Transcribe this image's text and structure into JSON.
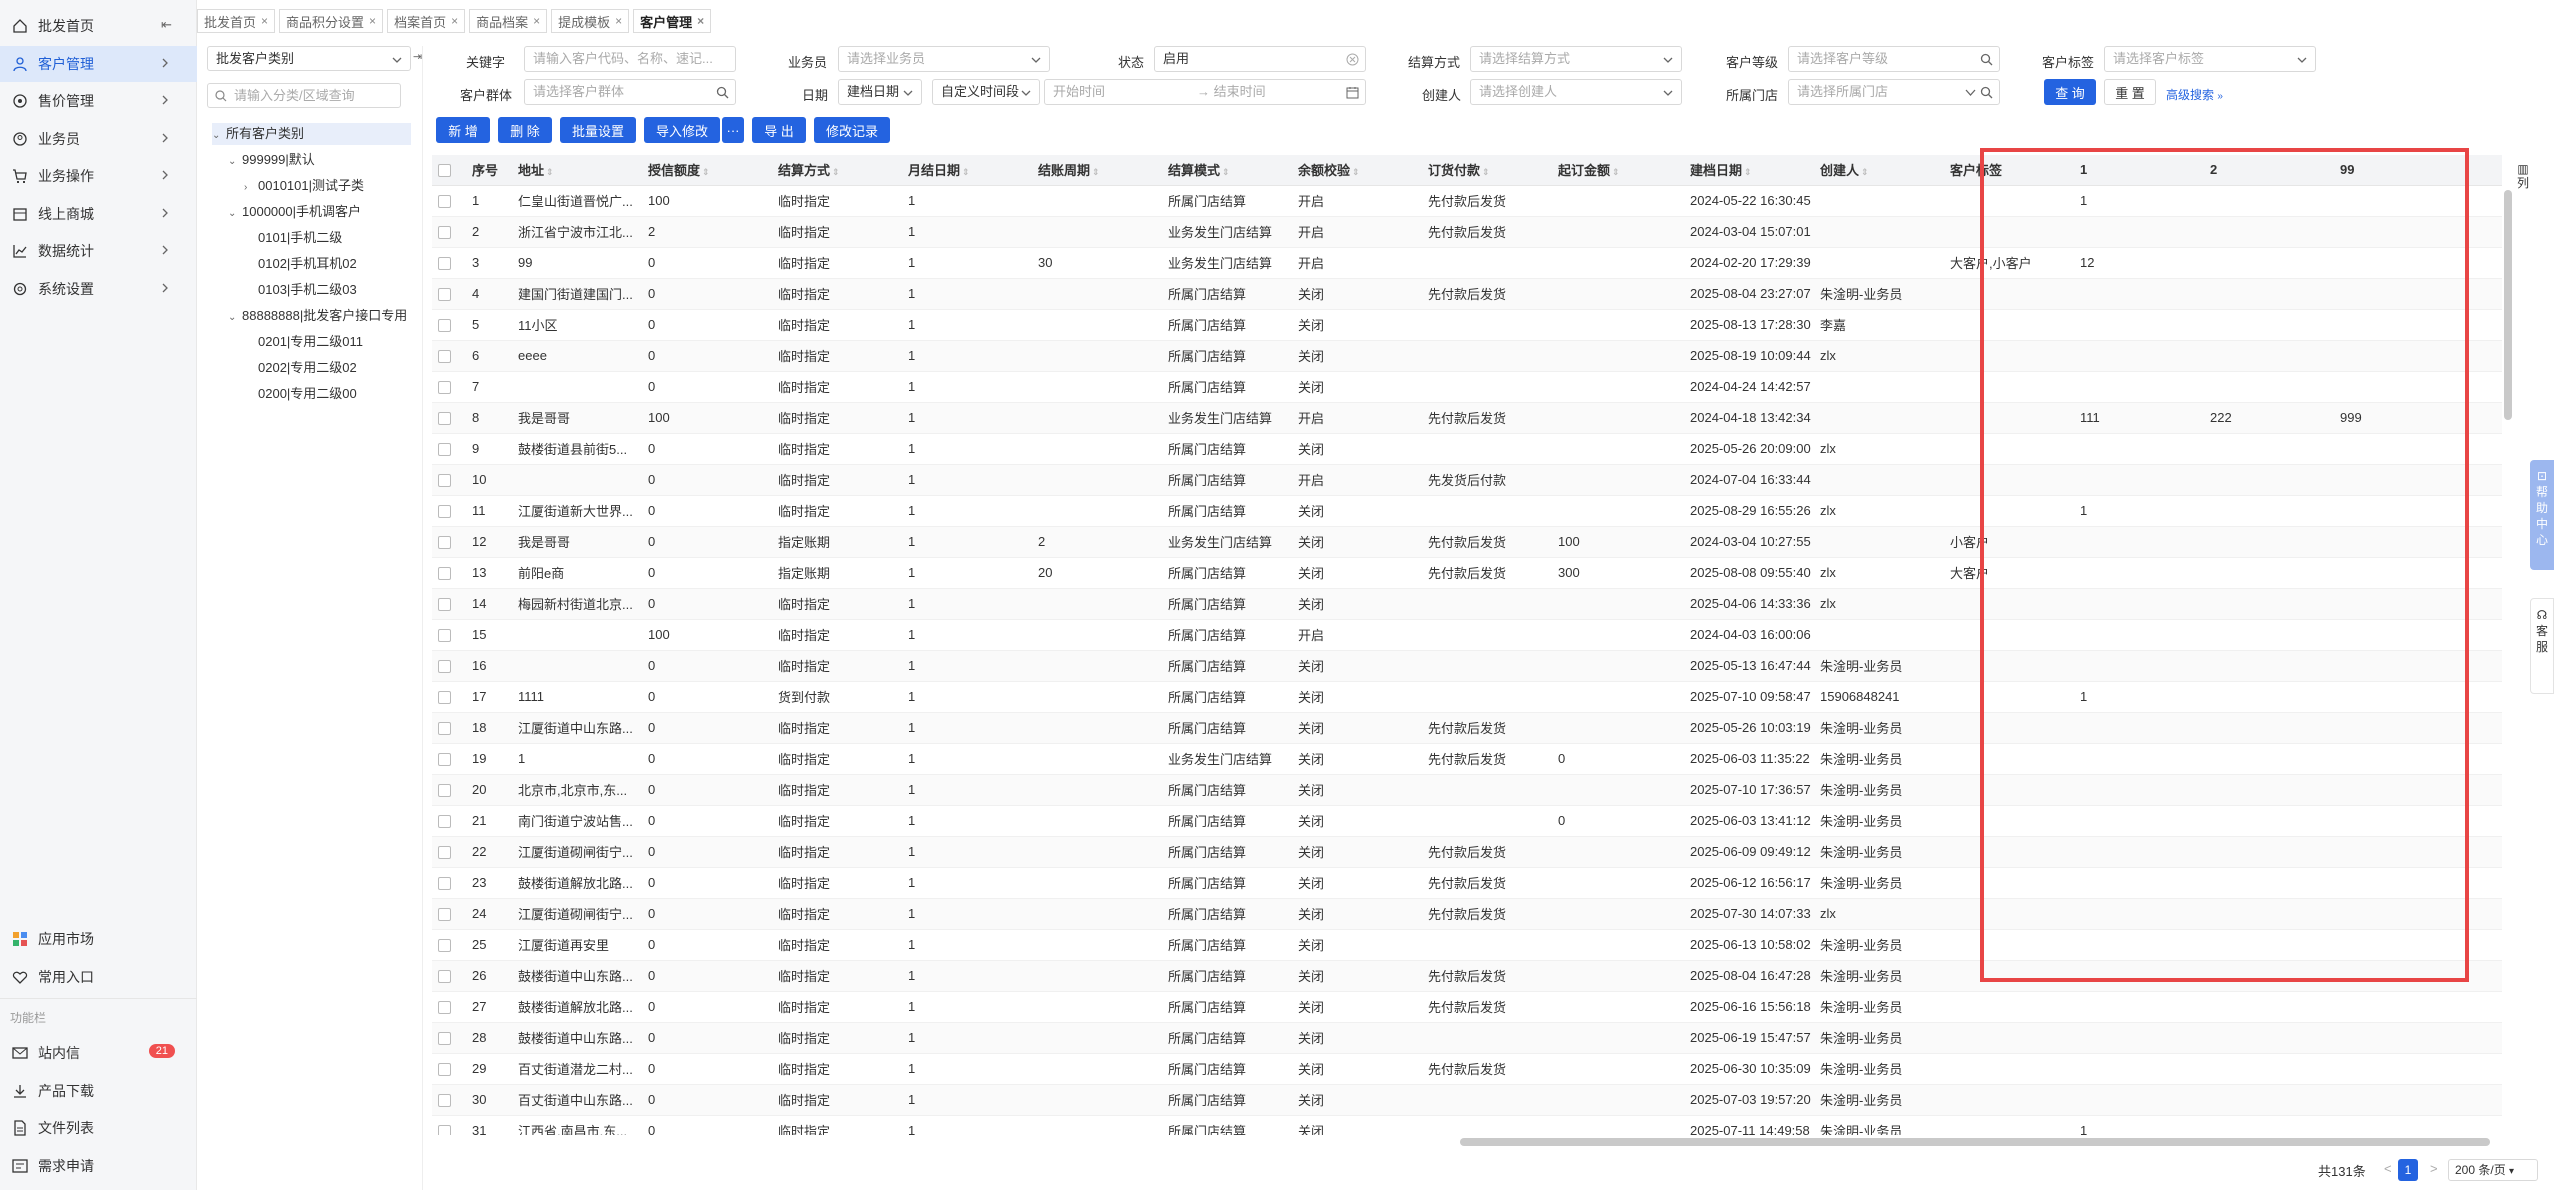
{
  "nav": {
    "items": [
      {
        "label": "批发首页",
        "icon": "home-icon"
      },
      {
        "label": "客户管理",
        "icon": "user-icon"
      },
      {
        "label": "售价管理",
        "icon": "price-icon"
      },
      {
        "label": "业务员",
        "icon": "person-icon"
      },
      {
        "label": "业务操作",
        "icon": "cart-icon"
      },
      {
        "label": "线上商城",
        "icon": "store-icon"
      },
      {
        "label": "数据统计",
        "icon": "chart-icon"
      },
      {
        "label": "系统设置",
        "icon": "gear-icon"
      }
    ],
    "bottom": [
      {
        "label": "应用市场",
        "icon": "apps-icon"
      },
      {
        "label": "常用入口",
        "icon": "heart-icon"
      }
    ],
    "section_label": "功能栏",
    "tools": [
      {
        "label": "站内信",
        "icon": "mail-icon",
        "badge": "21"
      },
      {
        "label": "产品下载",
        "icon": "download-icon"
      },
      {
        "label": "文件列表",
        "icon": "file-icon"
      },
      {
        "label": "需求申请",
        "icon": "request-icon"
      }
    ]
  },
  "tabs": [
    {
      "label": "批发首页"
    },
    {
      "label": "商品积分设置"
    },
    {
      "label": "档案首页"
    },
    {
      "label": "商品档案"
    },
    {
      "label": "提成模板"
    },
    {
      "label": "客户管理",
      "active": true
    }
  ],
  "category": {
    "select": "批发客户类别",
    "search_placeholder": "请输入分类/区域查询",
    "tree": [
      {
        "label": "所有客户类别",
        "level": 0,
        "arrow": "down",
        "selected": true
      },
      {
        "label": "999999|默认",
        "level": 1,
        "arrow": "down"
      },
      {
        "label": "0010101|测试子类",
        "level": 2,
        "arrow": "right"
      },
      {
        "label": "1000000|手机调客户",
        "level": 1,
        "arrow": "down"
      },
      {
        "label": "0101|手机二级",
        "level": 2,
        "arrow": ""
      },
      {
        "label": "0102|手机耳机02",
        "level": 2,
        "arrow": ""
      },
      {
        "label": "0103|手机二级03",
        "level": 2,
        "arrow": ""
      },
      {
        "label": "88888888|批发客户接口专用",
        "level": 1,
        "arrow": "down"
      },
      {
        "label": "0201|专用二级011",
        "level": 2,
        "arrow": ""
      },
      {
        "label": "0202|专用二级02",
        "level": 2,
        "arrow": ""
      },
      {
        "label": "0200|专用二级00",
        "level": 2,
        "arrow": ""
      }
    ]
  },
  "filters": {
    "keyword": {
      "label": "关键字",
      "placeholder": "请输入客户代码、名称、速记..."
    },
    "salesman": {
      "label": "业务员",
      "placeholder": "请选择业务员"
    },
    "status": {
      "label": "状态",
      "value": "启用"
    },
    "settle": {
      "label": "结算方式",
      "placeholder": "请选择结算方式"
    },
    "level": {
      "label": "客户等级",
      "placeholder": "请选择客户等级"
    },
    "tag": {
      "label": "客户标签",
      "placeholder": "请选择客户标签"
    },
    "group": {
      "label": "客户群体",
      "placeholder": "请选择客户群体"
    },
    "date": {
      "label": "日期",
      "type_value": "建档日期",
      "range_value": "自定义时间段",
      "start_placeholder": "开始时间",
      "end_placeholder": "结束时间"
    },
    "creator": {
      "label": "创建人",
      "placeholder": "请选择创建人"
    },
    "store": {
      "label": "所属门店",
      "placeholder": "请选择所属门店"
    },
    "query_label": "查 询",
    "reset_label": "重 置",
    "advanced_label": "高级搜索"
  },
  "toolbar": {
    "add": "新 增",
    "delete": "删 除",
    "batch": "批量设置",
    "import": "导入修改",
    "more": "···",
    "export": "导 出",
    "log": "修改记录"
  },
  "table": {
    "headers": [
      "序号",
      "地址",
      "授信额度",
      "结算方式",
      "月结日期",
      "结账周期",
      "结算模式",
      "余额校验",
      "订货付款",
      "起订金额",
      "建档日期",
      "创建人",
      "客户标签",
      "1",
      "2",
      "99"
    ],
    "rows": [
      [
        "1",
        "仁皇山街道晋悦广...",
        "100",
        "临时指定",
        "1",
        "",
        "所属门店结算",
        "开启",
        "先付款后发货",
        "",
        "2024-05-22 16:30:45",
        "",
        "",
        "1",
        "",
        ""
      ],
      [
        "2",
        "浙江省宁波市江北...",
        "2",
        "临时指定",
        "1",
        "",
        "业务发生门店结算",
        "开启",
        "先付款后发货",
        "",
        "2024-03-04 15:07:01",
        "",
        "",
        "",
        "",
        ""
      ],
      [
        "3",
        "99",
        "0",
        "临时指定",
        "1",
        "30",
        "业务发生门店结算",
        "开启",
        "",
        "",
        "2024-02-20 17:29:39",
        "",
        "大客户,小客户",
        "12",
        "",
        ""
      ],
      [
        "4",
        "建国门街道建国门...",
        "0",
        "临时指定",
        "1",
        "",
        "所属门店结算",
        "关闭",
        "先付款后发货",
        "",
        "2025-08-04 23:27:07",
        "朱淦明-业务员",
        "",
        "",
        "",
        ""
      ],
      [
        "5",
        "11小区",
        "0",
        "临时指定",
        "1",
        "",
        "所属门店结算",
        "关闭",
        "",
        "",
        "2025-08-13 17:28:30",
        "李嘉",
        "",
        "",
        "",
        ""
      ],
      [
        "6",
        "eeee",
        "0",
        "临时指定",
        "1",
        "",
        "所属门店结算",
        "关闭",
        "",
        "",
        "2025-08-19 10:09:44",
        "zlx",
        "",
        "",
        "",
        ""
      ],
      [
        "7",
        "",
        "0",
        "临时指定",
        "1",
        "",
        "所属门店结算",
        "关闭",
        "",
        "",
        "2024-04-24 14:42:57",
        "",
        "",
        "",
        "",
        ""
      ],
      [
        "8",
        "我是哥哥",
        "100",
        "临时指定",
        "1",
        "",
        "业务发生门店结算",
        "开启",
        "先付款后发货",
        "",
        "2024-04-18 13:42:34",
        "",
        "",
        "111",
        "222",
        "999"
      ],
      [
        "9",
        "鼓楼街道县前街5...",
        "0",
        "临时指定",
        "1",
        "",
        "所属门店结算",
        "关闭",
        "",
        "",
        "2025-05-26 20:09:00",
        "zlx",
        "",
        "",
        "",
        ""
      ],
      [
        "10",
        "",
        "0",
        "临时指定",
        "1",
        "",
        "所属门店结算",
        "开启",
        "先发货后付款",
        "",
        "2024-07-04 16:33:44",
        "",
        "",
        "",
        "",
        ""
      ],
      [
        "11",
        "江厦街道新大世界...",
        "0",
        "临时指定",
        "1",
        "",
        "所属门店结算",
        "关闭",
        "",
        "",
        "2025-08-29 16:55:26",
        "zlx",
        "",
        "1",
        "",
        ""
      ],
      [
        "12",
        "我是哥哥",
        "0",
        "指定账期",
        "1",
        "2",
        "业务发生门店结算",
        "关闭",
        "先付款后发货",
        "100",
        "2024-03-04 10:27:55",
        "",
        "小客户",
        "",
        "",
        ""
      ],
      [
        "13",
        "前阳e商",
        "0",
        "指定账期",
        "1",
        "20",
        "所属门店结算",
        "关闭",
        "先付款后发货",
        "300",
        "2025-08-08 09:55:40",
        "zlx",
        "大客户",
        "",
        "",
        ""
      ],
      [
        "14",
        "梅园新村街道北京...",
        "0",
        "临时指定",
        "1",
        "",
        "所属门店结算",
        "关闭",
        "",
        "",
        "2025-04-06 14:33:36",
        "zlx",
        "",
        "",
        "",
        ""
      ],
      [
        "15",
        "",
        "100",
        "临时指定",
        "1",
        "",
        "所属门店结算",
        "开启",
        "",
        "",
        "2024-04-03 16:00:06",
        "",
        "",
        "",
        "",
        ""
      ],
      [
        "16",
        "",
        "0",
        "临时指定",
        "1",
        "",
        "所属门店结算",
        "关闭",
        "",
        "",
        "2025-05-13 16:47:44",
        "朱淦明-业务员",
        "",
        "",
        "",
        ""
      ],
      [
        "17",
        "1111",
        "0",
        "货到付款",
        "1",
        "",
        "所属门店结算",
        "关闭",
        "",
        "",
        "2025-07-10 09:58:47",
        "15906848241",
        "",
        "1",
        "",
        ""
      ],
      [
        "18",
        "江厦街道中山东路...",
        "0",
        "临时指定",
        "1",
        "",
        "所属门店结算",
        "关闭",
        "先付款后发货",
        "",
        "2025-05-26 10:03:19",
        "朱淦明-业务员",
        "",
        "",
        "",
        ""
      ],
      [
        "19",
        "1",
        "0",
        "临时指定",
        "1",
        "",
        "业务发生门店结算",
        "关闭",
        "先付款后发货",
        "0",
        "2025-06-03 11:35:22",
        "朱淦明-业务员",
        "",
        "",
        "",
        ""
      ],
      [
        "20",
        "北京市,北京市,东...",
        "0",
        "临时指定",
        "1",
        "",
        "所属门店结算",
        "关闭",
        "",
        "",
        "2025-07-10 17:36:57",
        "朱淦明-业务员",
        "",
        "",
        "",
        ""
      ],
      [
        "21",
        "南门街道宁波站售...",
        "0",
        "临时指定",
        "1",
        "",
        "所属门店结算",
        "关闭",
        "",
        "0",
        "2025-06-03 13:41:12",
        "朱淦明-业务员",
        "",
        "",
        "",
        ""
      ],
      [
        "22",
        "江厦街道砌闸街宁...",
        "0",
        "临时指定",
        "1",
        "",
        "所属门店结算",
        "关闭",
        "先付款后发货",
        "",
        "2025-06-09 09:49:12",
        "朱淦明-业务员",
        "",
        "",
        "",
        ""
      ],
      [
        "23",
        "鼓楼街道解放北路...",
        "0",
        "临时指定",
        "1",
        "",
        "所属门店结算",
        "关闭",
        "先付款后发货",
        "",
        "2025-06-12 16:56:17",
        "朱淦明-业务员",
        "",
        "",
        "",
        ""
      ],
      [
        "24",
        "江厦街道砌闸街宁...",
        "0",
        "临时指定",
        "1",
        "",
        "所属门店结算",
        "关闭",
        "先付款后发货",
        "",
        "2025-07-30 14:07:33",
        "zlx",
        "",
        "",
        "",
        ""
      ],
      [
        "25",
        "江厦街道再安里",
        "0",
        "临时指定",
        "1",
        "",
        "所属门店结算",
        "关闭",
        "",
        "",
        "2025-06-13 10:58:02",
        "朱淦明-业务员",
        "",
        "",
        "",
        ""
      ],
      [
        "26",
        "鼓楼街道中山东路...",
        "0",
        "临时指定",
        "1",
        "",
        "所属门店结算",
        "关闭",
        "先付款后发货",
        "",
        "2025-08-04 16:47:28",
        "朱淦明-业务员",
        "",
        "",
        "",
        ""
      ],
      [
        "27",
        "鼓楼街道解放北路...",
        "0",
        "临时指定",
        "1",
        "",
        "所属门店结算",
        "关闭",
        "先付款后发货",
        "",
        "2025-06-16 15:56:18",
        "朱淦明-业务员",
        "",
        "",
        "",
        ""
      ],
      [
        "28",
        "鼓楼街道中山东路...",
        "0",
        "临时指定",
        "1",
        "",
        "所属门店结算",
        "关闭",
        "",
        "",
        "2025-06-19 15:47:57",
        "朱淦明-业务员",
        "",
        "",
        "",
        ""
      ],
      [
        "29",
        "百丈街道潜龙二村...",
        "0",
        "临时指定",
        "1",
        "",
        "所属门店结算",
        "关闭",
        "先付款后发货",
        "",
        "2025-06-30 10:35:09",
        "朱淦明-业务员",
        "",
        "",
        "",
        ""
      ],
      [
        "30",
        "百丈街道中山东路...",
        "0",
        "临时指定",
        "1",
        "",
        "所属门店结算",
        "关闭",
        "",
        "",
        "2025-07-03 19:57:20",
        "朱淦明-业务员",
        "",
        "",
        "",
        ""
      ],
      [
        "31",
        "江西省,南昌市,东...",
        "0",
        "临时指定",
        "1",
        "",
        "所属门店结算",
        "关闭",
        "",
        "",
        "2025-07-11 14:49:58",
        "朱淦明-业务员",
        "",
        "1",
        "",
        ""
      ]
    ]
  },
  "pagination": {
    "total": "共131条",
    "current": "1",
    "page_size": "200 条/页",
    "prev": "<",
    "next": ">"
  },
  "float": {
    "column": "列",
    "help": "帮助中心",
    "service": "客服"
  },
  "colors": {
    "primary": "#2463e0",
    "highlight": "#e84545",
    "active_nav_bg": "#dde8fa"
  }
}
